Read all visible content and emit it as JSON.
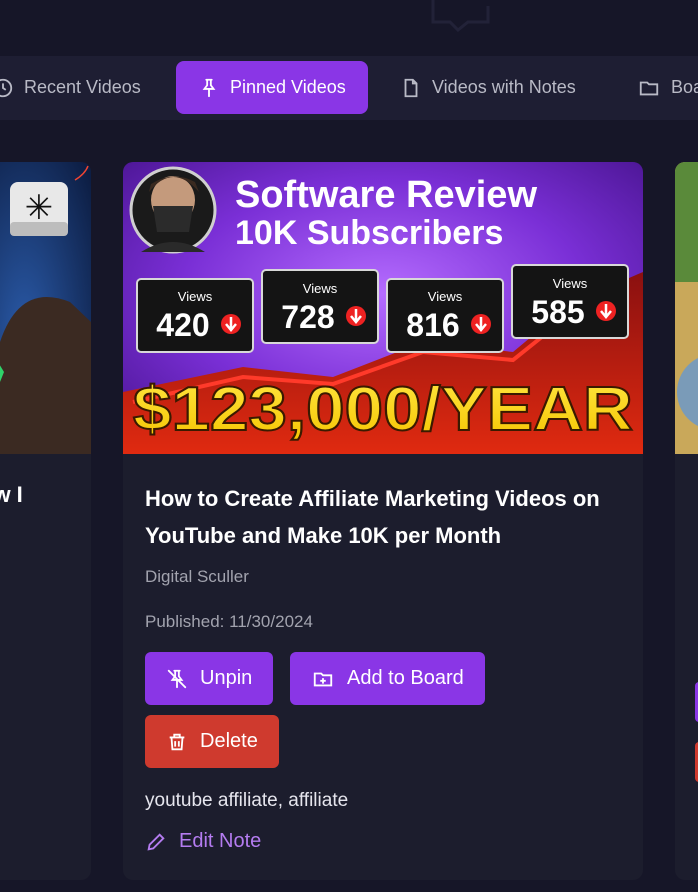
{
  "tabs": [
    {
      "label": "Recent Videos",
      "icon": "clock-icon",
      "active": false
    },
    {
      "label": "Pinned Videos",
      "icon": "pin-icon",
      "active": true
    },
    {
      "label": "Videos with Notes",
      "icon": "note-icon",
      "active": false
    },
    {
      "label": "Boa",
      "icon": "folder-icon",
      "active": false
    }
  ],
  "left_card": {
    "title_fragment": "ow I"
  },
  "card": {
    "thumbnail": {
      "headline_1": "Software Review",
      "headline_2": "10K Subscribers",
      "stats": [
        {
          "label": "Views",
          "value": "420"
        },
        {
          "label": "Views",
          "value": "728"
        },
        {
          "label": "Views",
          "value": "816"
        },
        {
          "label": "Views",
          "value": "585"
        }
      ],
      "income": "$123,000/YEAR"
    },
    "title": "How to Create Affiliate Marketing Videos on YouTube and Make 10K per Month",
    "channel": "Digital Sculler",
    "published": "Published: 11/30/2024",
    "buttons": {
      "unpin": "Unpin",
      "add_to_board": "Add to Board",
      "delete": "Delete"
    },
    "tags": "youtube affiliate, affiliate",
    "edit_note": "Edit Note"
  },
  "colors": {
    "accent_purple": "#8a36e6",
    "delete_red": "#cf3a2e",
    "card_bg": "#1c1d2d",
    "page_bg": "#161628",
    "link_purple": "#b47cf0"
  }
}
